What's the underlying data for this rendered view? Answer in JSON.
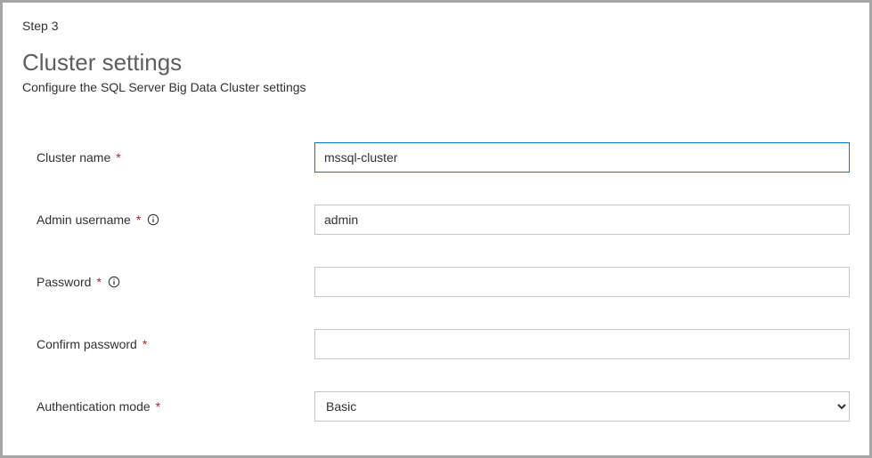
{
  "step_label": "Step 3",
  "title": "Cluster settings",
  "subtitle": "Configure the SQL Server Big Data Cluster settings",
  "fields": {
    "cluster_name": {
      "label": "Cluster name",
      "value": "mssql-cluster",
      "required": true
    },
    "admin_username": {
      "label": "Admin username",
      "value": "admin",
      "required": true,
      "info": true
    },
    "password": {
      "label": "Password",
      "value": "",
      "required": true,
      "info": true
    },
    "confirm_password": {
      "label": "Confirm password",
      "value": "",
      "required": true
    },
    "authentication_mode": {
      "label": "Authentication mode",
      "value": "Basic",
      "required": true,
      "options": [
        "Basic"
      ]
    }
  },
  "required_marker": "*"
}
